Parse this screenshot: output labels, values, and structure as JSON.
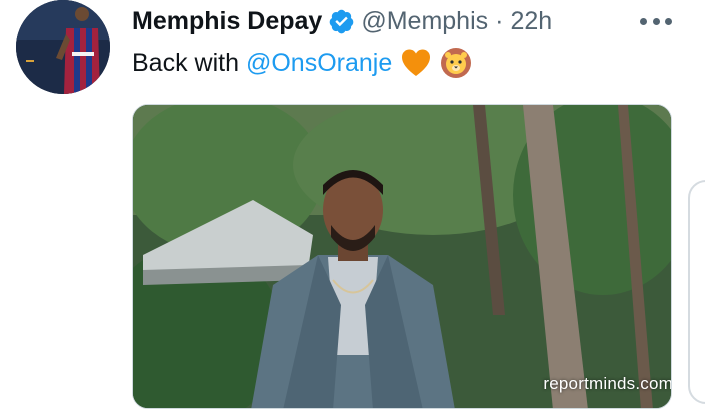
{
  "tweet": {
    "display_name": "Memphis Depay",
    "handle": "@Memphis",
    "separator": "·",
    "time_ago": "22h",
    "text_prefix": "Back with",
    "mention": "@OnsOranje",
    "emojis": [
      "orange-heart",
      "lion-face"
    ]
  },
  "media": {
    "watermark": "reportminds.com"
  },
  "colors": {
    "link": "#1d9bf0",
    "verified": "#1d9bf0",
    "secondary_text": "#536471",
    "primary_text": "#0f1419"
  }
}
